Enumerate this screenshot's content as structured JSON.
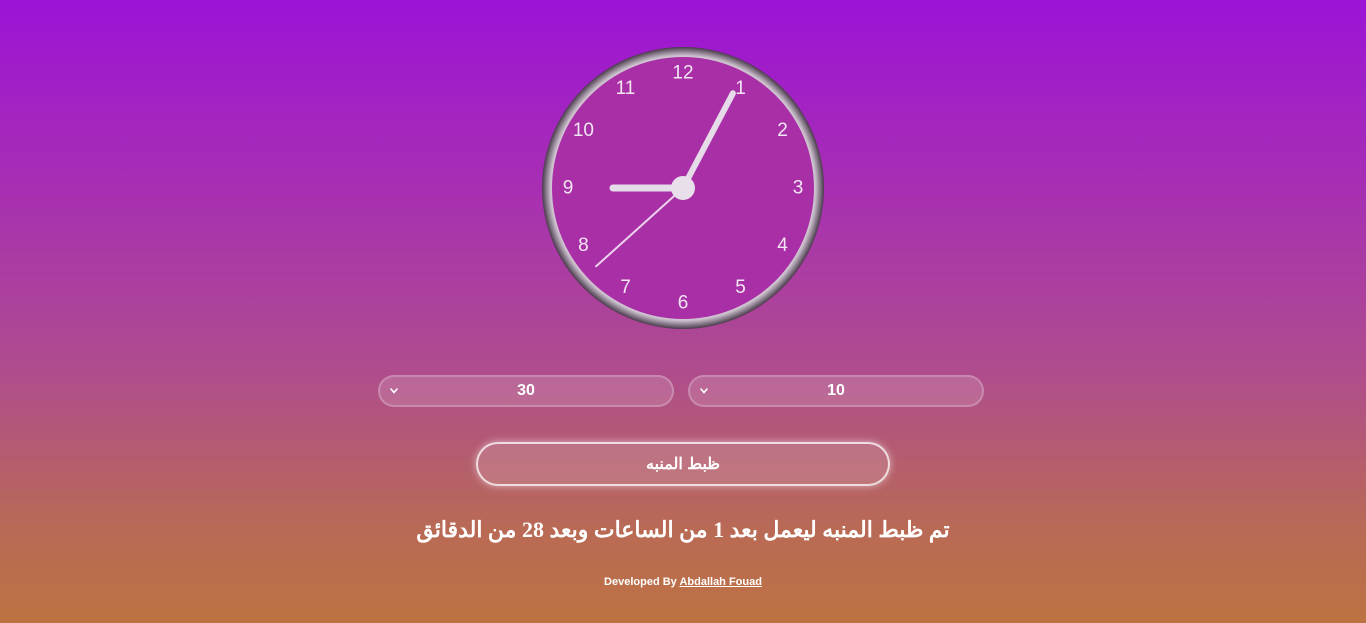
{
  "clock": {
    "numbers": [
      "12",
      "1",
      "2",
      "3",
      "4",
      "5",
      "6",
      "7",
      "8",
      "9",
      "10",
      "11"
    ],
    "time": {
      "hour": 8,
      "minute": 4,
      "second": 38
    }
  },
  "selects": {
    "minutes": {
      "value": "30"
    },
    "hours": {
      "value": "10"
    }
  },
  "set_button": {
    "label": "ظبط المنبه"
  },
  "status_message": "تم ظبط المنبه ليعمل بعد 1 من الساعات وبعد 28 من الدقائق",
  "footer": {
    "prefix": "Developed By",
    "author": "Abdallah Fouad"
  }
}
